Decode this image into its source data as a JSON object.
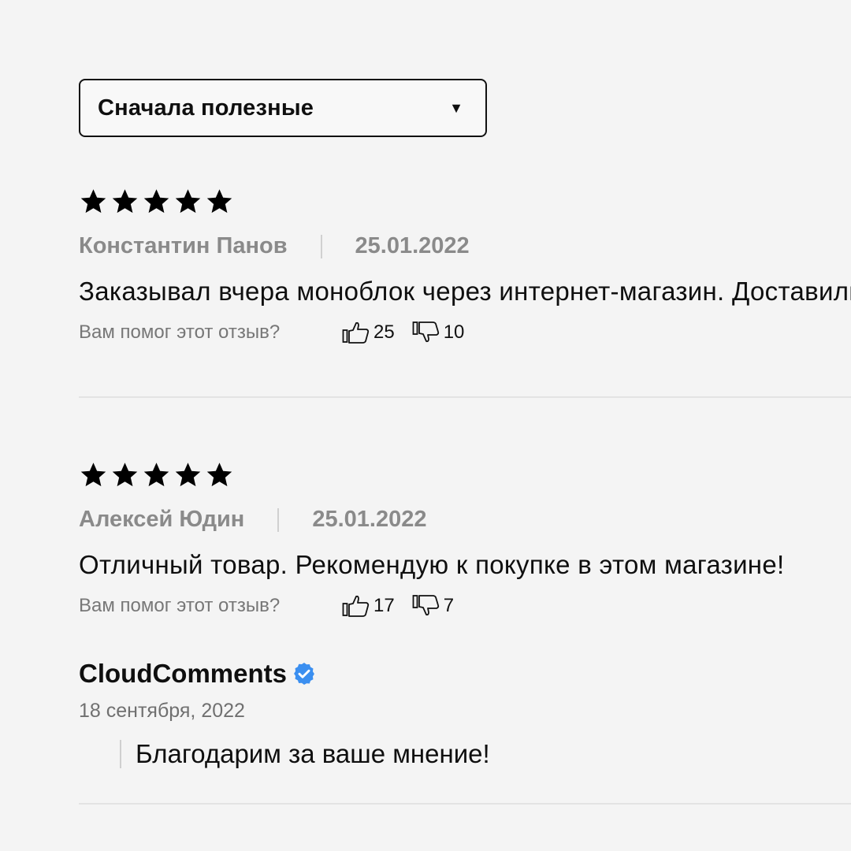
{
  "sort": {
    "label": "Сначала полезные",
    "caret_icon": "caret-down-icon"
  },
  "reviews": [
    {
      "rating": 5,
      "author": "Константин Панов",
      "date": "25.01.2022",
      "text": "Заказывал вчера моноблок через интернет-магазин. Доставили",
      "helpful_question": "Вам помог этот отзыв?",
      "likes": "25",
      "dislikes": "10"
    },
    {
      "rating": 5,
      "author": "Алексей Юдин",
      "date": "25.01.2022",
      "text": "Отличный товар. Рекомендую к покупке в этом магазине!",
      "helpful_question": "Вам помог этот отзыв?",
      "likes": "17",
      "dislikes": "7"
    }
  ],
  "reply": {
    "author": "CloudComments",
    "verified_icon": "verified-badge-icon",
    "date": "18 сентября, 2022",
    "text": "Благодарим за ваше мнение!"
  },
  "colors": {
    "accent_verified": "#3b8ff0",
    "muted_text": "#8a8a8a",
    "background": "#f4f4f4"
  }
}
